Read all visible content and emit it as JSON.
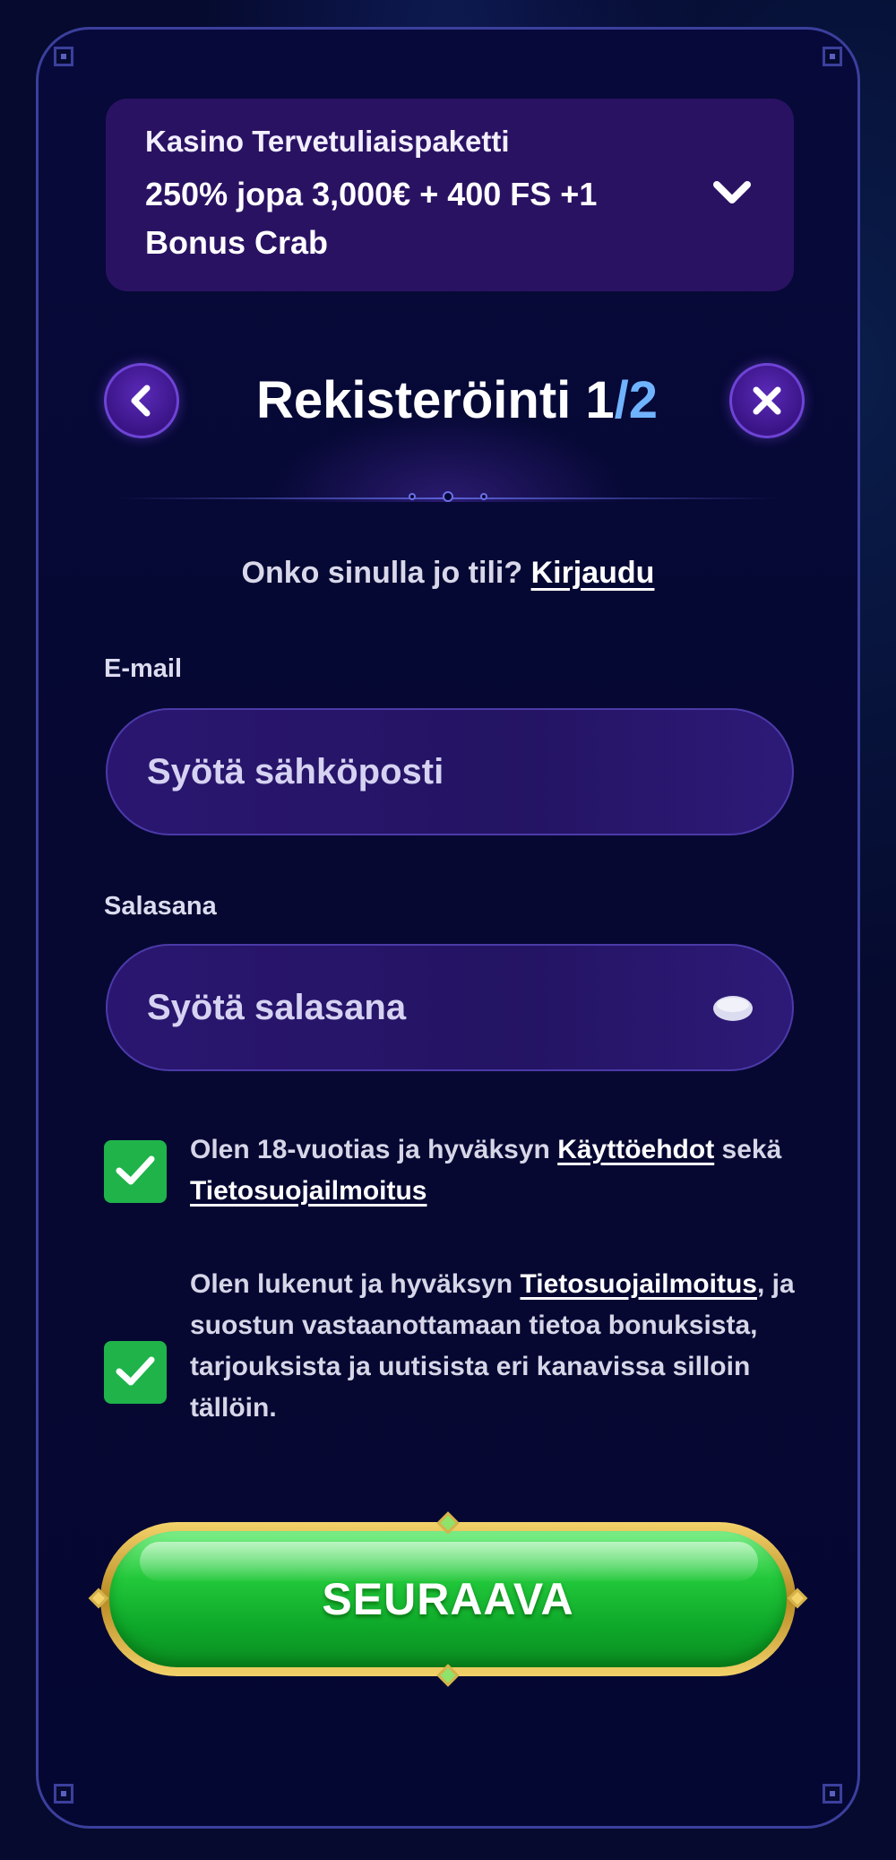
{
  "promo": {
    "title": "Kasino Tervetuliaispaketti",
    "offer": "250% jopa 3,000€ + 400 FS +1 Bonus Crab"
  },
  "header": {
    "title": "Rekisteröinti",
    "step_current": "1",
    "step_separator": "/",
    "step_total": "2"
  },
  "login_prompt": {
    "text": "Onko sinulla jo tili?",
    "link": "Kirjaudu"
  },
  "email": {
    "label": "E-mail",
    "placeholder": "Syötä sähköposti",
    "value": ""
  },
  "password": {
    "label": "Salasana",
    "placeholder": "Syötä salasana",
    "value": ""
  },
  "consent_terms": {
    "checked": true,
    "text_before": "Olen 18-vuotias ja hyväksyn",
    "link_terms": "Käyttöehdot",
    "text_middle": "sekä",
    "link_privacy": "Tietosuojailmoitus"
  },
  "consent_marketing": {
    "checked": true,
    "text_before": "Olen lukenut ja hyväksyn",
    "link_privacy": "Tietosuojailmoitus",
    "text_after": ", ja suostun vastaanottamaan tietoa bonuksista, tarjouksista ja uutisista eri kanavissa silloin tällöin."
  },
  "cta": {
    "label": "SEURAAVA"
  },
  "colors": {
    "background": "#050a2e",
    "promo_bg": "#2a1263",
    "accent_blue": "#6fb3ff",
    "checkbox_green": "#1fb34a",
    "cta_green": "#22c83a",
    "gold": "#f3d26a"
  }
}
